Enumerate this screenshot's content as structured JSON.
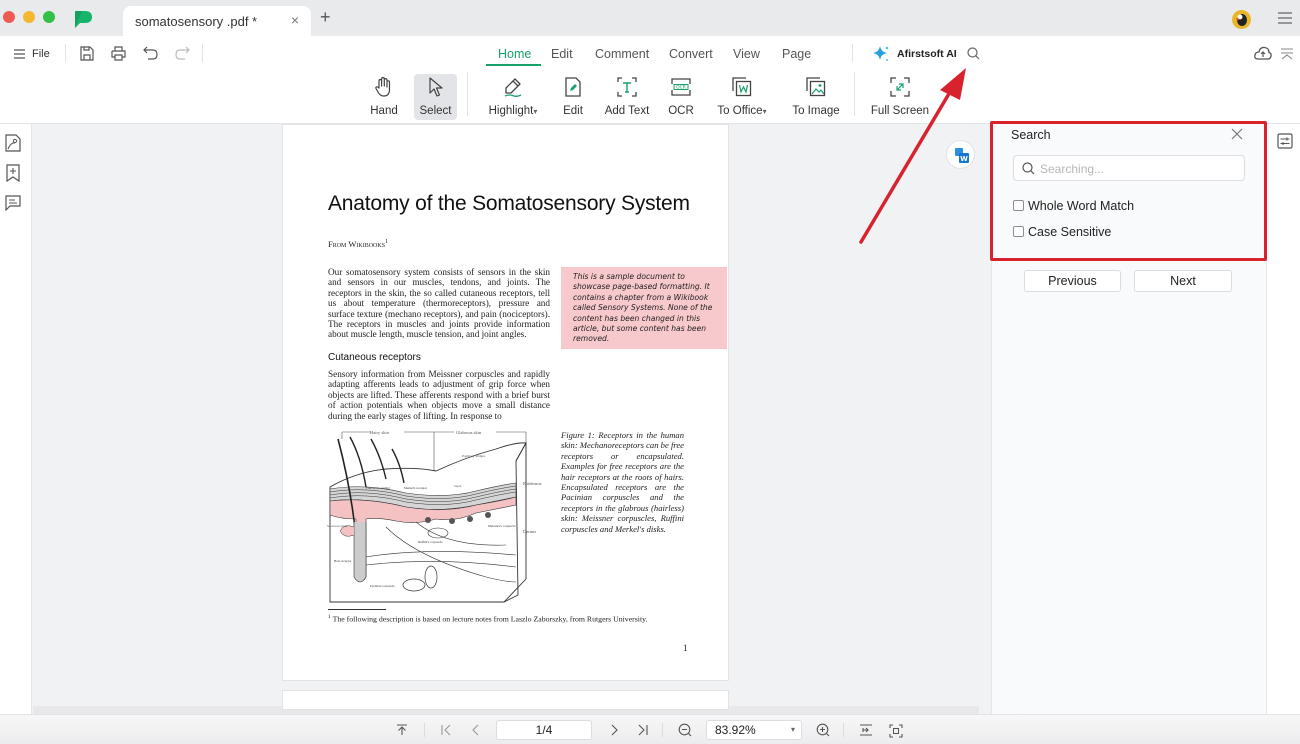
{
  "window": {
    "tab_title": "somatosensory .pdf *",
    "tab_close": "×",
    "new_tab": "+",
    "traffic_lights": {
      "close": "#ee5b52",
      "minimize": "#f5b631",
      "maximize": "#33c046"
    },
    "brand_color": "#19b46b"
  },
  "toolbar": {
    "file_label": "File",
    "menu_tabs": [
      {
        "label": "Home",
        "active": true
      },
      {
        "label": "Edit",
        "active": false
      },
      {
        "label": "Comment",
        "active": false
      },
      {
        "label": "Convert",
        "active": false
      },
      {
        "label": "View",
        "active": false
      },
      {
        "label": "Page",
        "active": false
      }
    ],
    "ai_label": "Afirstsoft AI",
    "tools": [
      {
        "label": "Hand",
        "icon": "hand-icon"
      },
      {
        "label": "Select",
        "icon": "cursor-icon",
        "selected": true
      },
      {
        "label": "Highlight",
        "icon": "highlighter-icon",
        "dropdown": true
      },
      {
        "label": "Edit",
        "icon": "edit-icon"
      },
      {
        "label": "Add Text",
        "icon": "add-text-icon"
      },
      {
        "label": "OCR",
        "icon": "ocr-icon"
      },
      {
        "label": "To Office",
        "icon": "to-office-icon",
        "dropdown": true
      },
      {
        "label": "To Image",
        "icon": "to-image-icon"
      },
      {
        "label": "Full Screen",
        "icon": "fullscreen-icon"
      }
    ],
    "dropdown_caret": "▾",
    "accent_color": "#18a06a"
  },
  "document": {
    "title": "Anatomy of the Somatosensory System",
    "from": "From Wikibooks",
    "from_footnote_mark": "1",
    "intro": "Our somatosensory system consists of sensors in the skin and sensors in our muscles, tendons, and joints. The receptors in the skin, the so called cutaneous receptors, tell us about temperature (thermoreceptors), pressure and surface texture (mechano receptors), and pain (nociceptors). The receptors in muscles and joints provide information about muscle length, muscle tension, and joint angles.",
    "callout": "This is a sample document to showcase page-based formatting. It contains a chapter from a Wikibook called Sensory Systems. None of the content has been changed in this article, but some content has been removed.",
    "section_heading": "Cutaneous receptors",
    "section_text": "Sensory information from Meissner corpuscles and rapidly adapting afferents leads to adjustment of grip force when objects are lifted. These afferents respond with a brief burst of action potentials when objects move a small distance during the early stages of lifting. In response to",
    "figure_caption": "Figure 1: Receptors in the human skin: Mechanoreceptors can be free receptors or encapsulated. Examples for free receptors are the hair receptors at the roots of hairs. Encapsulated receptors are the Pacinian corpuscles and the receptors in the glabrous (hairless) skin: Meissner corpuscles, Ruffini corpuscles and Merkel's disks.",
    "figure_labels": {
      "hairy_skin": "Hairy skin",
      "glabrous_skin": "Glabrous skin",
      "papillary_ridges": "Papillary Ridges",
      "epidermis": "Epidermis",
      "dermis": "Dermis",
      "free_nerve": "Free nerve ending",
      "merkel": "Merkel's receptor",
      "septa": "Septa",
      "sebaceous": "Sebaceous gland",
      "ruffini": "Ruffini's corpuscle",
      "meissner": "Meissner's corpuscle",
      "hair_receptor": "Hair receptor",
      "pacinian": "Pacinian corpuscle"
    },
    "footnote": "The following description is based on lecture notes from Laszlo Zaborszky, from Rutgers University.",
    "footnote_mark": "1",
    "page_number": "1",
    "callout_color": "#f8c9cc"
  },
  "search_panel": {
    "title": "Search",
    "placeholder": "Searching...",
    "value": "",
    "options": [
      {
        "label": "Whole Word Match",
        "checked": false
      },
      {
        "label": "Case Sensitive",
        "checked": false
      }
    ],
    "previous_label": "Previous",
    "next_label": "Next",
    "highlight_color": "#d8232f"
  },
  "status_bar": {
    "page_indicator": "1/4",
    "zoom_level": "83.92%",
    "zoom_caret": "▾"
  }
}
